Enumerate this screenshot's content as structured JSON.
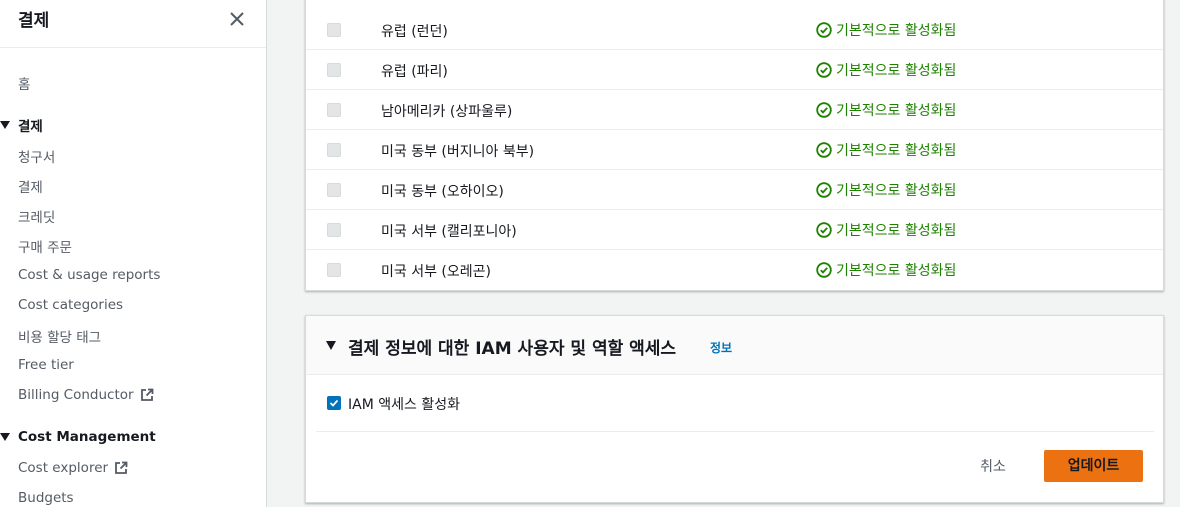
{
  "sidebar": {
    "title": "결제",
    "home": "홈",
    "billing_section": "결제",
    "billing_items": [
      {
        "label": "청구서"
      },
      {
        "label": "결제"
      },
      {
        "label": "크레딧"
      },
      {
        "label": "구매 주문"
      },
      {
        "label": "Cost & usage reports"
      },
      {
        "label": "Cost categories"
      },
      {
        "label": "비용 할당 태그"
      },
      {
        "label": "Free tier"
      },
      {
        "label": "Billing Conductor",
        "external": true
      }
    ],
    "cost_section": "Cost Management",
    "cost_items": [
      {
        "label": "Cost explorer",
        "external": true
      },
      {
        "label": "Budgets"
      }
    ]
  },
  "regions": [
    {
      "name": "유럽 (런던)",
      "status": "기본적으로 활성화됨"
    },
    {
      "name": "유럽 (파리)",
      "status": "기본적으로 활성화됨"
    },
    {
      "name": "남아메리카 (상파울루)",
      "status": "기본적으로 활성화됨"
    },
    {
      "name": "미국 동부 (버지니아 북부)",
      "status": "기본적으로 활성화됨"
    },
    {
      "name": "미국 동부 (오하이오)",
      "status": "기본적으로 활성화됨"
    },
    {
      "name": "미국 서부 (캘리포니아)",
      "status": "기본적으로 활성화됨"
    },
    {
      "name": "미국 서부 (오레곤)",
      "status": "기본적으로 활성화됨"
    }
  ],
  "iam_panel": {
    "title": "결제 정보에 대한 IAM 사용자 및 역할 액세스",
    "info_link": "정보",
    "checkbox_label": "IAM 액세스 활성화",
    "checkbox_checked": true,
    "cancel_label": "취소",
    "update_label": "업데이트"
  },
  "colors": {
    "status_green": "#1d8102",
    "primary_orange": "#ec7211",
    "link_blue": "#0073bb"
  }
}
